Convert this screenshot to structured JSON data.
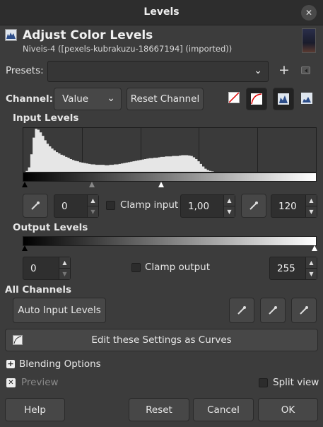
{
  "window": {
    "title": "Levels",
    "close_icon": "close-icon"
  },
  "header": {
    "title": "Adjust Color Levels",
    "subtitle": "Niveis-4 ([pexels-kubrakuzu-18667194] (imported))"
  },
  "presets": {
    "label": "Presets:",
    "value": ""
  },
  "channel": {
    "label": "Channel:",
    "value": "Value",
    "reset_label": "Reset Channel"
  },
  "input_levels": {
    "heading": "Input Levels",
    "low": "0",
    "gamma": "1,00",
    "high": "120",
    "clamp_label": "Clamp input",
    "clamp_checked": false
  },
  "output_levels": {
    "heading": "Output Levels",
    "low": "0",
    "high": "255",
    "clamp_label": "Clamp output",
    "clamp_checked": false
  },
  "all_channels": {
    "heading": "All Channels",
    "auto_label": "Auto Input Levels"
  },
  "curves": {
    "label": "Edit these Settings as Curves"
  },
  "blending": {
    "label": "Blending Options"
  },
  "preview": {
    "label": "Preview",
    "checked": true
  },
  "split_view": {
    "label": "Split view",
    "checked": false
  },
  "footer": {
    "help": "Help",
    "reset": "Reset",
    "cancel": "Cancel",
    "ok": "OK"
  },
  "histogram": [
    0,
    2,
    10,
    40,
    78,
    98,
    96,
    90,
    82,
    72,
    64,
    58,
    53,
    49,
    45,
    42,
    39,
    37,
    34,
    32,
    29,
    27,
    25,
    24,
    22,
    21,
    20,
    19,
    18,
    17,
    17,
    16,
    16,
    16,
    16,
    15,
    15,
    16,
    16,
    17,
    17,
    18,
    19,
    20,
    21,
    22,
    23,
    24,
    25,
    26,
    27,
    28,
    29,
    30,
    31,
    31,
    32,
    32,
    33,
    34,
    34,
    35,
    35,
    35,
    36,
    36,
    36,
    37,
    38,
    38,
    38,
    37,
    36,
    33,
    29,
    24,
    18,
    12,
    7,
    4,
    2,
    1,
    0,
    0,
    0,
    0,
    0,
    0,
    0,
    0,
    0,
    0,
    0,
    0,
    0,
    0,
    0,
    0,
    0,
    0,
    0,
    0,
    0,
    0,
    0,
    0,
    0,
    0,
    0,
    0,
    0,
    0,
    0,
    0,
    0,
    0,
    0,
    0,
    0,
    0,
    0,
    0,
    0,
    0,
    0,
    0
  ]
}
